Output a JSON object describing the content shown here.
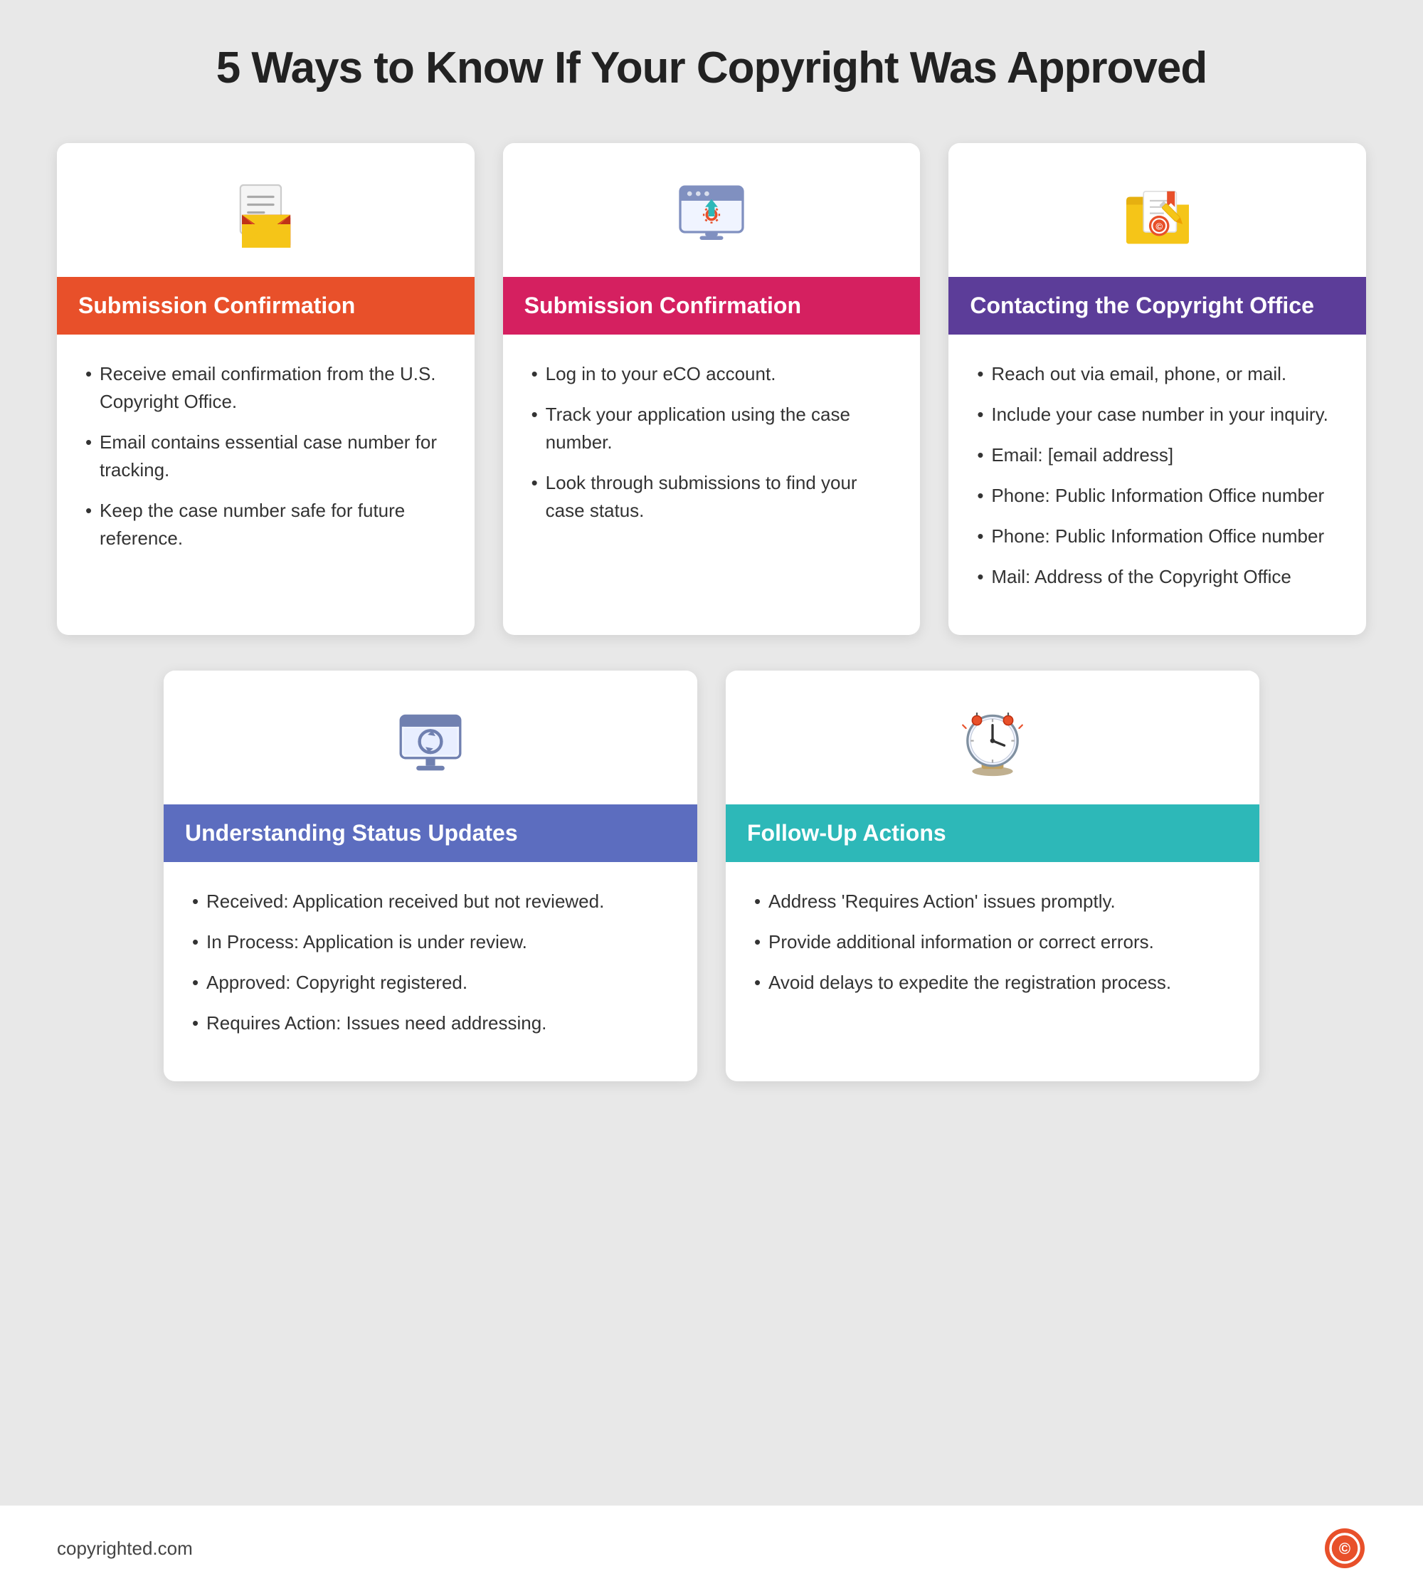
{
  "page": {
    "title": "5 Ways to Know If Your Copyright Was Approved",
    "background": "#e8e8e8"
  },
  "cards": {
    "top": [
      {
        "id": "submission-confirmation-1",
        "header": "Submission Confirmation",
        "header_color": "orange",
        "items": [
          "Receive email confirmation from the U.S. Copyright Office.",
          "Email contains essential case number for tracking.",
          "Keep the case number safe for future reference."
        ]
      },
      {
        "id": "submission-confirmation-2",
        "header": "Submission Confirmation",
        "header_color": "crimson",
        "items": [
          "Log in to your eCO account.",
          "Track your application using the case number.",
          "Look through submissions to find your case status."
        ]
      },
      {
        "id": "contacting-copyright-office",
        "header": "Contacting the Copyright Office",
        "header_color": "purple",
        "items": [
          "Reach out via email, phone, or mail.",
          "Include your case number in your inquiry.",
          "Email: [email address]",
          "Phone: Public Information Office number",
          "Phone: Public Information Office number",
          "Mail: Address of the Copyright Office"
        ]
      }
    ],
    "bottom": [
      {
        "id": "understanding-status-updates",
        "header": "Understanding Status Updates",
        "header_color": "blue",
        "items": [
          "Received: Application received but not reviewed.",
          "In Process: Application is under review.",
          "Approved: Copyright registered.",
          "Requires Action: Issues need addressing."
        ]
      },
      {
        "id": "follow-up-actions",
        "header": "Follow-Up Actions",
        "header_color": "teal",
        "items": [
          "Address 'Requires Action' issues promptly.",
          "Provide additional information or correct errors.",
          "Avoid delays to expedite the registration process."
        ]
      }
    ]
  },
  "footer": {
    "domain": "copyrighted.com"
  }
}
